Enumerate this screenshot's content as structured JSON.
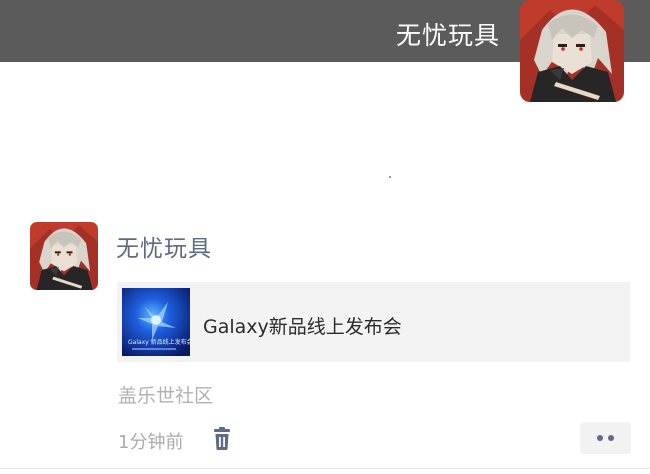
{
  "header": {
    "name": "无忧玩具",
    "avatar_icon": "anime-character-avatar"
  },
  "post": {
    "author": "无忧玩具",
    "avatar_icon": "anime-character-avatar",
    "link_card": {
      "title": "Galaxy新品线上发布会",
      "thumbnail_icon": "galaxy-launch-poster",
      "thumbnail_text": "Galaxy 新品线上发布会"
    },
    "source": "盖乐世社区",
    "time": "1分钟前",
    "delete_icon": "trash-icon",
    "more_icon": "more-dots-icon"
  },
  "colors": {
    "header_bg": "#5b5b5b",
    "name_color": "#5d6a7f",
    "card_bg": "#f3f3f3",
    "muted_text": "#ababab"
  }
}
